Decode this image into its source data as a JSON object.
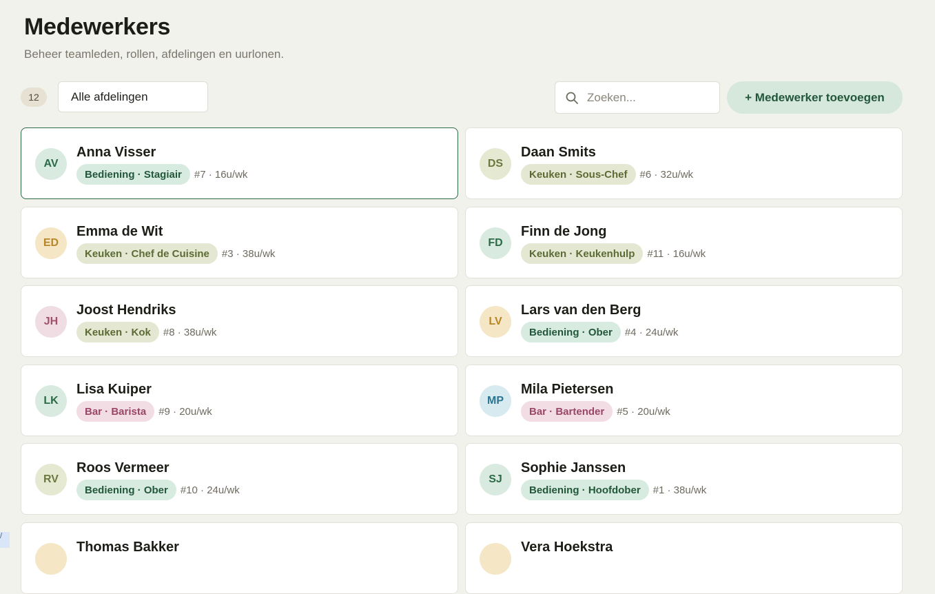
{
  "header": {
    "title": "Medewerkers",
    "subtitle": "Beheer teamleden, rollen, afdelingen en uurlonen."
  },
  "toolbar": {
    "count": "12",
    "department_filter": "Alle afdelingen",
    "search_placeholder": "Zoeken...",
    "add_label": "+ Medewerker toevoegen"
  },
  "employees": [
    {
      "initials": "AV",
      "name": "Anna Visser",
      "tag": "Bediening · Stagiair",
      "meta": "#7 · 16u/wk",
      "avatar_color": "green",
      "department": "bediening",
      "selected": true
    },
    {
      "initials": "DS",
      "name": "Daan Smits",
      "tag": "Keuken · Sous-Chef",
      "meta": "#6 · 32u/wk",
      "avatar_color": "olive",
      "department": "keuken"
    },
    {
      "initials": "ED",
      "name": "Emma de Wit",
      "tag": "Keuken · Chef de Cuisine",
      "meta": "#3 · 38u/wk",
      "avatar_color": "amber",
      "department": "keuken"
    },
    {
      "initials": "FD",
      "name": "Finn de Jong",
      "tag": "Keuken · Keukenhulp",
      "meta": "#11 · 16u/wk",
      "avatar_color": "green",
      "department": "keuken"
    },
    {
      "initials": "JH",
      "name": "Joost Hendriks",
      "tag": "Keuken · Kok",
      "meta": "#8 · 38u/wk",
      "avatar_color": "pink",
      "department": "keuken"
    },
    {
      "initials": "LV",
      "name": "Lars van den Berg",
      "tag": "Bediening · Ober",
      "meta": "#4 · 24u/wk",
      "avatar_color": "amber",
      "department": "bediening"
    },
    {
      "initials": "LK",
      "name": "Lisa Kuiper",
      "tag": "Bar · Barista",
      "meta": "#9 · 20u/wk",
      "avatar_color": "green",
      "department": "bar"
    },
    {
      "initials": "MP",
      "name": "Mila Pietersen",
      "tag": "Bar · Bartender",
      "meta": "#5 · 20u/wk",
      "avatar_color": "blue",
      "department": "bar"
    },
    {
      "initials": "RV",
      "name": "Roos Vermeer",
      "tag": "Bediening · Ober",
      "meta": "#10 · 24u/wk",
      "avatar_color": "olive",
      "department": "bediening"
    },
    {
      "initials": "SJ",
      "name": "Sophie Janssen",
      "tag": "Bediening · Hoofdober",
      "meta": "#1 · 38u/wk",
      "avatar_color": "green",
      "department": "bediening"
    },
    {
      "initials": "",
      "name": "Thomas Bakker",
      "tag": "",
      "meta": "",
      "avatar_color": "amber",
      "department": ""
    },
    {
      "initials": "",
      "name": "Vera Hoekstra",
      "tag": "",
      "meta": "",
      "avatar_color": "amber",
      "department": ""
    }
  ],
  "corner_tab_text": "/"
}
